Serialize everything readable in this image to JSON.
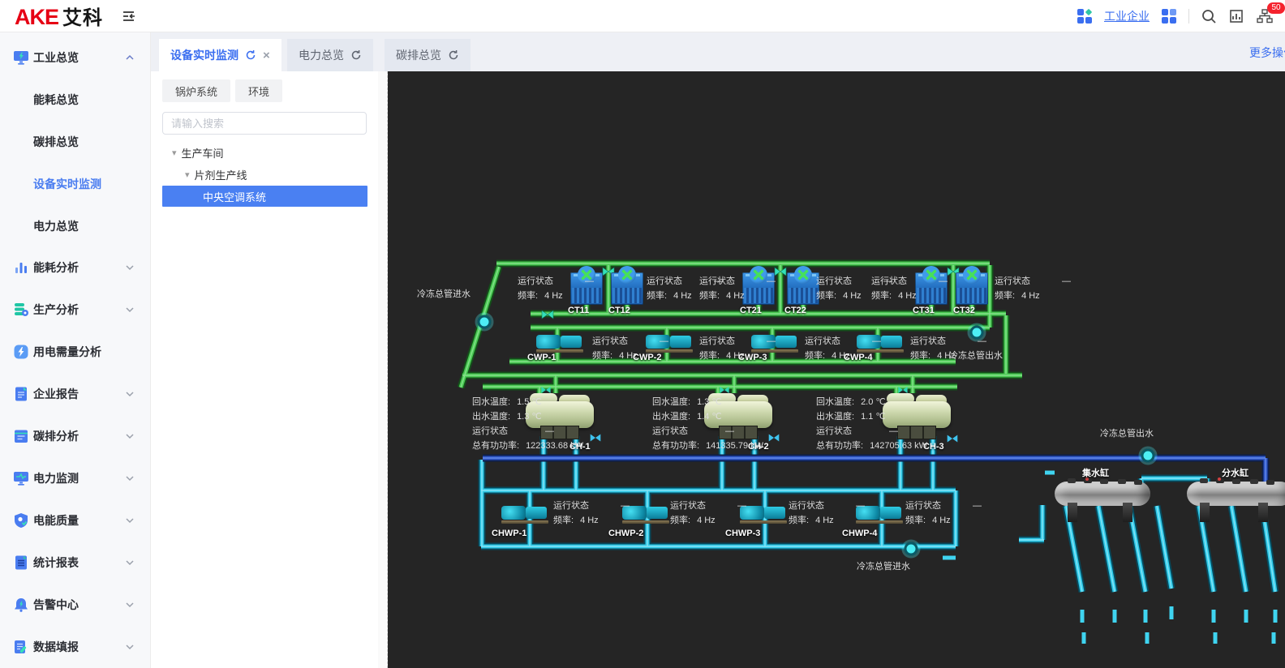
{
  "header": {
    "logo_text_en": "AKE",
    "logo_text_cn": "艾科",
    "workspace_link": "工业企业",
    "alarm_count": "50"
  },
  "sidebar": {
    "overview": {
      "label": "工业总览"
    },
    "overview_children": [
      {
        "label": "能耗总览"
      },
      {
        "label": "碳排总览"
      },
      {
        "label": "设备实时监测"
      },
      {
        "label": "电力总览"
      }
    ],
    "sections": [
      {
        "label": "能耗分析"
      },
      {
        "label": "生产分析"
      },
      {
        "label": "用电需量分析"
      },
      {
        "label": "企业报告"
      },
      {
        "label": "碳排分析"
      },
      {
        "label": "电力监测"
      },
      {
        "label": "电能质量"
      },
      {
        "label": "统计报表"
      },
      {
        "label": "告警中心"
      },
      {
        "label": "数据填报"
      }
    ]
  },
  "tabbar": {
    "tabs": [
      {
        "label": "设备实时监测"
      },
      {
        "label": "电力总览"
      },
      {
        "label": "碳排总览"
      }
    ],
    "more_actions": "更多操作"
  },
  "panel": {
    "filter_buttons": [
      {
        "label": "锅炉系统"
      },
      {
        "label": "环境"
      }
    ],
    "search_placeholder": "请输入搜索",
    "tree": {
      "level1": "生产车间",
      "level2": "片剂生产线",
      "selected": "中央空调系统"
    }
  },
  "diagram": {
    "field_labels": {
      "status": "运行状态",
      "freq": "频率:",
      "return_temp": "回水温度:",
      "supply_temp": "出水温度:",
      "power": "总有功功率:"
    },
    "pipe_labels": {
      "cond_main_in": "冷冻总管进水",
      "cond_main_out": "冷冻总管出水",
      "chilled_main_out": "冷冻总管出水",
      "chilled_main_in": "冷冻总管进水"
    },
    "cooling_towers": [
      {
        "name": "CT11",
        "status": "—",
        "freq": "4 Hz"
      },
      {
        "name": "CT12",
        "status": "—",
        "freq": "4 Hz"
      },
      {
        "name": "CT21",
        "status": "—",
        "freq": "4 Hz"
      },
      {
        "name": "CT22",
        "status": "—",
        "freq": "4 Hz"
      },
      {
        "name": "CT31",
        "status": "—",
        "freq": "4 Hz"
      },
      {
        "name": "CT32",
        "status": "—",
        "freq": "4 Hz"
      }
    ],
    "cond_pumps": [
      {
        "name": "CWP-1",
        "status": "—",
        "freq": "4 Hz"
      },
      {
        "name": "CWP-2",
        "status": "—",
        "freq": "4 Hz"
      },
      {
        "name": "CWP-3",
        "status": "—",
        "freq": "4 Hz"
      },
      {
        "name": "CWP-4",
        "status": "—",
        "freq": "4 Hz"
      }
    ],
    "chillers": [
      {
        "name": "CH-1",
        "return_temp": "1.5 ℃",
        "supply_temp": "1.3 ℃",
        "status": "—",
        "power": "122333.68 kW"
      },
      {
        "name": "CH-2",
        "return_temp": "1.3 ℃",
        "supply_temp": "1.4 ℃",
        "status": "—",
        "power": "141335.79 kW"
      },
      {
        "name": "CH-3",
        "return_temp": "2.0 ℃",
        "supply_temp": "1.1 ℃",
        "status": "—",
        "power": "142705.63 kW"
      }
    ],
    "chw_pumps": [
      {
        "name": "CHWP-1",
        "status": "—",
        "freq": "4 Hz"
      },
      {
        "name": "CHWP-2",
        "status": "—",
        "freq": "4 Hz"
      },
      {
        "name": "CHWP-3",
        "status": "—",
        "freq": "4 Hz"
      },
      {
        "name": "CHWP-4",
        "status": "—",
        "freq": "4 Hz"
      }
    ],
    "tanks": [
      {
        "name": "集水缸"
      },
      {
        "name": "分水缸"
      }
    ]
  }
}
